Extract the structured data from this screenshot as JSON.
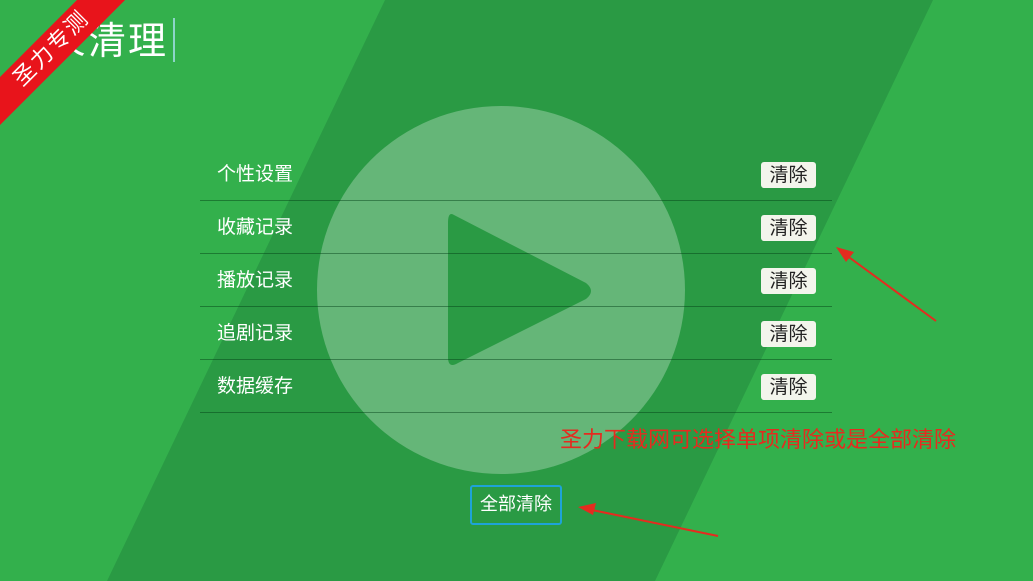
{
  "watermark": "圣力专测",
  "page": {
    "title": "录清理"
  },
  "background": {
    "primary": "#33b04c",
    "band": "#2a9a44"
  },
  "items": [
    {
      "label": "个性设置",
      "button": "清除"
    },
    {
      "label": "收藏记录",
      "button": "清除"
    },
    {
      "label": "播放记录",
      "button": "清除"
    },
    {
      "label": "追剧记录",
      "button": "清除"
    },
    {
      "label": "数据缓存",
      "button": "清除"
    }
  ],
  "clear_all_label": "全部清除",
  "annotation": "圣力下载网可选择单项清除或是全部清除",
  "annotation_color": "#e52b1f"
}
